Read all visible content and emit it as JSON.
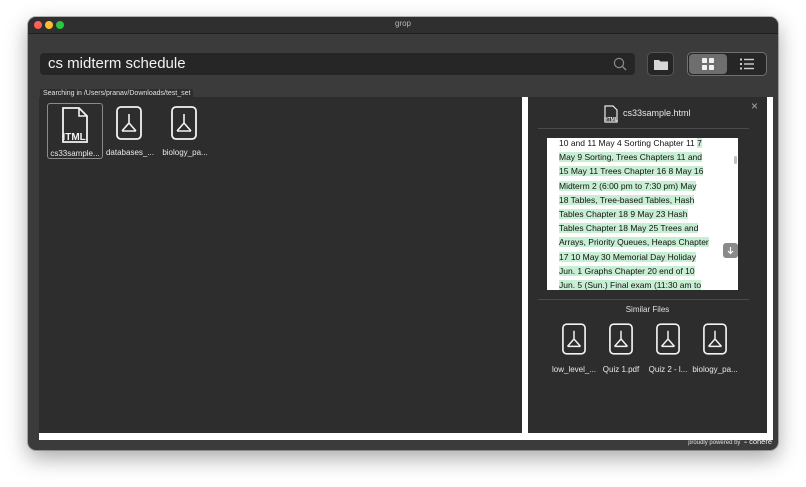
{
  "window": {
    "title": "grop"
  },
  "search": {
    "query": "cs midterm schedule"
  },
  "scope": {
    "label": "Searching in /Users/pranav/Downloads/test_set"
  },
  "results": [
    {
      "label": "cs33sample...",
      "type": "html",
      "icon": "html-file-icon",
      "selected": true
    },
    {
      "label": "databases_...",
      "type": "pdf",
      "icon": "pdf-file-icon",
      "selected": false
    },
    {
      "label": "biology_pa...",
      "type": "pdf",
      "icon": "pdf-file-icon",
      "selected": false
    }
  ],
  "preview": {
    "filename": "cs33sample.html",
    "file_icon": "html-file-icon",
    "lines": [
      {
        "plain": "10 and 11   May   4 Sorting Chapter 11 ",
        "hl": "7"
      },
      {
        "plain": "",
        "hl": "May   9 Sorting, Trees Chapters 11 and"
      },
      {
        "plain": "",
        "hl": "15   May 11 Trees Chapter 16 8 May 16"
      },
      {
        "plain": "",
        "hl": "Midterm 2 (6:00 pm to 7:30 pm)     May"
      },
      {
        "plain": "",
        "hl": "18 Tables, Tree-based Tables, Hash"
      },
      {
        "plain": "",
        "hl": "Tables Chapter 18 9 May 23 Hash"
      },
      {
        "plain": "",
        "hl": "Tables Chapter 18   May 25 Trees and"
      },
      {
        "plain": "",
        "hl": "Arrays, Priority Queues, Heaps Chapter"
      },
      {
        "plain": "",
        "hl": "17 10 May 30 Memorial Day Holiday"
      },
      {
        "plain": "",
        "hl": "Jun.   1 Graphs Chapter 20 end of 10"
      },
      {
        "plain": "",
        "hl": "Jun.  5 (Sun.) Final exam (11:30 am to"
      }
    ],
    "close_glyph": "×"
  },
  "similar": {
    "title": "Similar Files",
    "items": [
      {
        "label": "low_level_...",
        "icon": "pdf-file-icon"
      },
      {
        "label": "Quiz 1.pdf",
        "icon": "pdf-file-icon"
      },
      {
        "label": "Quiz 2 - l...",
        "icon": "pdf-file-icon"
      },
      {
        "label": "biology_pa...",
        "icon": "pdf-file-icon"
      }
    ]
  },
  "footer": {
    "text": "proudly powered by",
    "brand": "cohere"
  },
  "colors": {
    "window_bg": "#3b3b3b",
    "pane_bg": "#2d2d2d",
    "highlight": "#c8efd4",
    "close": "#fe5f57",
    "minimize": "#febc2e",
    "maximize": "#28c840"
  }
}
